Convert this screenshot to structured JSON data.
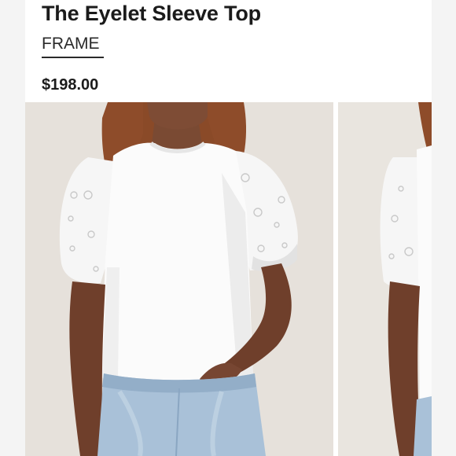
{
  "product": {
    "title": "The Eyelet Sleeve Top",
    "brand": "FRAME",
    "price": "$198.00"
  },
  "gallery": {
    "images": [
      {
        "alt": "Model wearing The Eyelet Sleeve Top, front view"
      },
      {
        "alt": "Model wearing The Eyelet Sleeve Top, side view"
      }
    ]
  },
  "colors": {
    "background": "#f4f4f4",
    "card": "#ffffff",
    "photo_backdrop": "#e9e5df",
    "top": "#fbfbfb",
    "skin": "#7a4a33",
    "hair": "#8a4a28",
    "denim": "#a9c1d8"
  }
}
